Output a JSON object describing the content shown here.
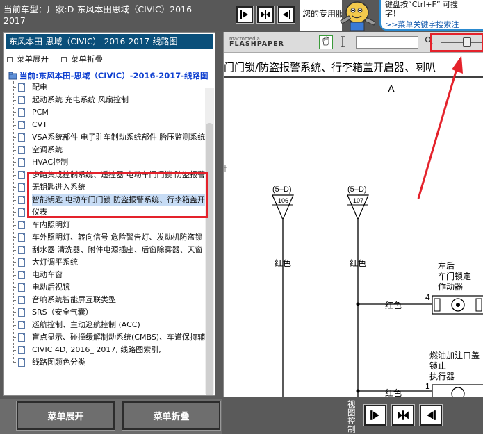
{
  "header": {
    "title": "当前车型：厂家:D-东风本田思域（CIVIC）2016-2017",
    "notice": "您的专用服务专线",
    "bubble_line1": "键盘按“Ctrl+F” 可搜",
    "bubble_line2": "字！",
    "bubble_link": ">>菜单关键字搜索注"
  },
  "sidebar": {
    "tree_title": "东风本田-思域（CIVIC）-2016-2017-线路图",
    "expand_label": "菜单展开",
    "collapse_label": "菜单折叠",
    "current_node": "当前:东风本田-思域（CIVIC）-2016-2017-线路图",
    "items": [
      {
        "label": "配电"
      },
      {
        "label": "起动系统 充电系统 风扇控制"
      },
      {
        "label": "PCM"
      },
      {
        "label": "CVT"
      },
      {
        "label": "VSA系统部件 电子驻车制动系统部件 胎压监测系统"
      },
      {
        "label": "空调系统"
      },
      {
        "label": "HVAC控制"
      },
      {
        "label": "多路集成控制系统、遥控器 电动车门门锁 防盗报警"
      },
      {
        "label": "无钥匙进入系统"
      },
      {
        "label": "智能钥匙 电动车门门锁 防盗报警系统、行李箱盖开"
      },
      {
        "label": "仪表"
      },
      {
        "label": "车内照明灯"
      },
      {
        "label": "车外照明灯、转向信号 危险警告灯、发动机防盗锁"
      },
      {
        "label": "刮水器 清洗器、附件电源插座、后窗除雾器、天窗"
      },
      {
        "label": "大灯调平系统"
      },
      {
        "label": "电动车窗"
      },
      {
        "label": "电动后视镜"
      },
      {
        "label": "音响系统智能屏互联类型"
      },
      {
        "label": "SRS（安全气囊）"
      },
      {
        "label": "巡航控制、主动巡航控制 (ACC)"
      },
      {
        "label": "盲点显示、碰撞缓解制动系统(CMBS)、车道保持辅"
      },
      {
        "label": "CIVIC 4D, 2016_ 2017, 线路图索引,"
      },
      {
        "label": "线路图颜色分类"
      }
    ]
  },
  "bottom": {
    "expand_button": "菜单展开",
    "collapse_button": "菜单折叠",
    "view_label": "视图控制"
  },
  "viewer": {
    "logo_top": "macromedia",
    "logo_bottom": "FLASHPAPER",
    "doc_title": "门门锁/防盗报警系统、行李箱盖开启器、喇叭",
    "letter": "A",
    "conn1_code": "(5–D)",
    "conn1_pin": "106",
    "conn2_code": "(5–D)",
    "conn2_pin": "107",
    "wire_color": "红色",
    "comp1_line1": "左后",
    "comp1_line2": "车门锁定",
    "comp1_line3": "作动器",
    "comp1_pin": "4",
    "comp2_line1": "燃油加注口盖",
    "comp2_line2": "锁止",
    "comp2_line3": "执行器",
    "comp2_pin": "1"
  }
}
